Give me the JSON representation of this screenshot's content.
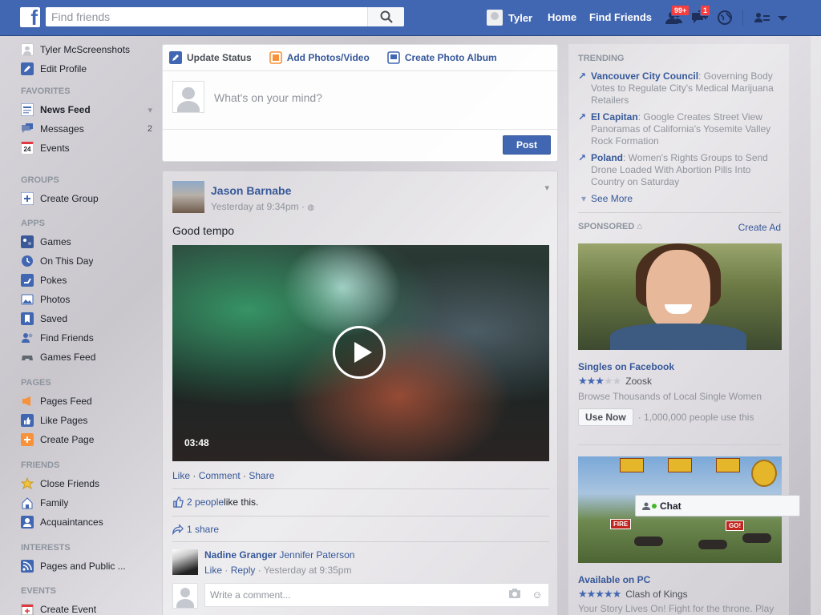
{
  "topbar": {
    "logo": "f",
    "search_placeholder": "Find friends",
    "user_name": "Tyler",
    "home_label": "Home",
    "find_friends_label": "Find Friends",
    "friend_requests_badge": "99+",
    "messages_badge": "1",
    "brand_color": "#4267b2"
  },
  "sidebar": {
    "profile_name": "Tyler McScreenshots",
    "edit_profile": "Edit Profile",
    "sections": {
      "favorites": "FAVORITES",
      "groups": "GROUPS",
      "apps": "APPS",
      "pages": "PAGES",
      "friends": "FRIENDS",
      "interests": "INTERESTS",
      "events": "EVENTS"
    },
    "favorites": [
      {
        "label": "News Feed",
        "icon": "news-feed-icon"
      },
      {
        "label": "Messages",
        "count": "2",
        "icon": "messages-icon"
      },
      {
        "label": "Events",
        "icon": "calendar-icon",
        "icon_text": "24"
      }
    ],
    "groups": [
      {
        "label": "Create Group",
        "icon": "create-group-icon"
      }
    ],
    "apps": [
      {
        "label": "Games",
        "icon": "games-icon"
      },
      {
        "label": "On This Day",
        "icon": "on-this-day-icon"
      },
      {
        "label": "Pokes",
        "icon": "pokes-icon"
      },
      {
        "label": "Photos",
        "icon": "photos-icon"
      },
      {
        "label": "Saved",
        "icon": "saved-icon"
      },
      {
        "label": "Find Friends",
        "icon": "find-friends-icon"
      },
      {
        "label": "Games Feed",
        "icon": "games-feed-icon"
      }
    ],
    "pages": [
      {
        "label": "Pages Feed",
        "icon": "pages-feed-icon"
      },
      {
        "label": "Like Pages",
        "icon": "like-pages-icon"
      },
      {
        "label": "Create Page",
        "icon": "create-page-icon"
      }
    ],
    "friends": [
      {
        "label": "Close Friends",
        "icon": "star-icon"
      },
      {
        "label": "Family",
        "icon": "family-icon"
      },
      {
        "label": "Acquaintances",
        "icon": "acquaintances-icon"
      }
    ],
    "interests": [
      {
        "label": "Pages and Public ...",
        "icon": "rss-icon"
      }
    ],
    "events": [
      {
        "label": "Create Event",
        "icon": "create-event-icon"
      }
    ]
  },
  "composer": {
    "tab_update": "Update Status",
    "tab_photos": "Add Photos/Video",
    "tab_album": "Create Photo Album",
    "placeholder": "What's on your mind?",
    "post_label": "Post"
  },
  "story": {
    "author": "Jason Barnabe",
    "timestamp": "Yesterday at 9:34pm",
    "meta_sep": "·",
    "text": "Good tempo",
    "video_duration": "03:48",
    "actions": {
      "like": "Like",
      "comment": "Comment",
      "share": "Share",
      "sep": " · "
    },
    "likes_link": "2 people",
    "likes_text": " like this.",
    "shares": "1 share",
    "comment": {
      "author": "Nadine Granger",
      "tagged": "Jennifer Paterson",
      "like": "Like",
      "reply": "Reply",
      "time": "Yesterday at 9:35pm",
      "sep": " · "
    },
    "write_placeholder": "Write a comment..."
  },
  "trending": {
    "heading": "TRENDING",
    "items": [
      {
        "title": "Vancouver City Council",
        "desc": ": Governing Body Votes to Regulate City's Medical Marijuana Retailers"
      },
      {
        "title": "El Capitan",
        "desc": ": Google Creates Street View Panoramas of California's Yosemite Valley Rock Formation"
      },
      {
        "title": "Poland",
        "desc": ": Women's Rights Groups to Send Drone Loaded With Abortion Pills Into Country on Saturday"
      }
    ],
    "see_more": "See More"
  },
  "sponsored": {
    "heading": "SPONSORED",
    "create_ad": "Create Ad",
    "ad1": {
      "title": "Singles on Facebook",
      "rating": 2.5,
      "advertiser": "Zoosk",
      "desc": "Browse Thousands of Local Single Women",
      "button": "Use Now",
      "users": "· 1,000,000 people use this"
    },
    "ad2": {
      "fire_label": "FIRE",
      "go_label": "GO!",
      "title": "Available on PC",
      "rating": 4.5,
      "advertiser": "Clash of Kings",
      "desc": "Your Story Lives On! Fight for the throne. Play"
    }
  },
  "chat": {
    "label": "Chat"
  }
}
